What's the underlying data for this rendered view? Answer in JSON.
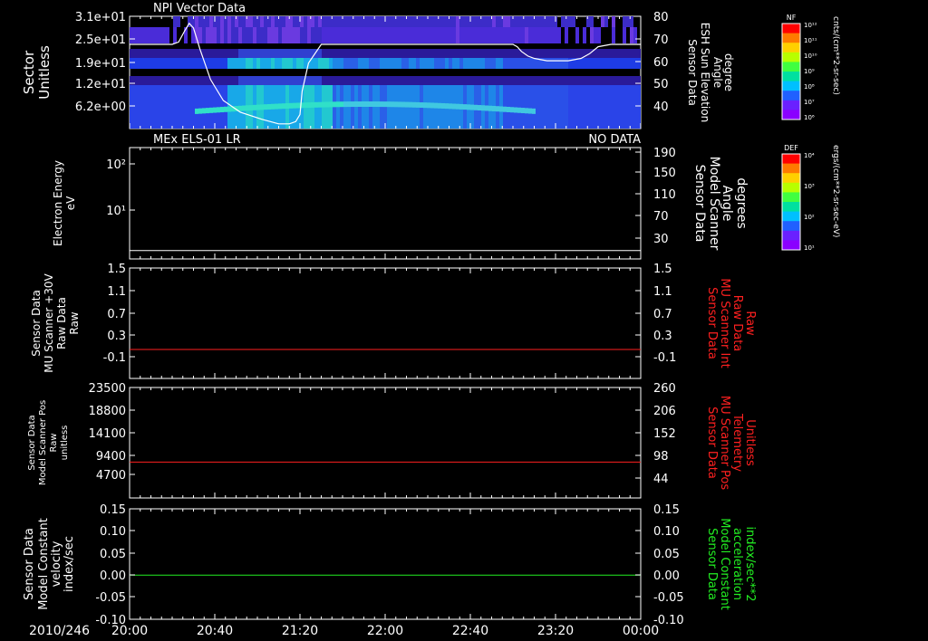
{
  "colors": {
    "frame": "#ffffff",
    "red_trace": "#ff2020",
    "green_trace": "#22ee22",
    "sun_curve": "#ffffff",
    "background": "#000000"
  },
  "panels": {
    "p1": {
      "title": "NPI Vector Data",
      "left_label": [
        "Sector",
        "Unitless"
      ],
      "right_label": [
        "Sensor Data",
        "ESH Sun Elevation",
        "Angle",
        "degree"
      ],
      "left_ticks": [
        "3.1e+01",
        "2.5e+01",
        "1.9e+01",
        "1.2e+01",
        "6.2e+00"
      ],
      "right_ticks": [
        "80",
        "70",
        "60",
        "50",
        "40"
      ],
      "colorbar": {
        "label": "NF",
        "units": "cnts/(cm**2-sr-sec)",
        "ticks": [
          "10¹²",
          "10¹¹",
          "10¹⁰",
          "10⁹",
          "10⁸",
          "10⁷",
          "10⁶"
        ]
      }
    },
    "p2": {
      "title": "MEx ELS-01 LR",
      "status": "NO DATA",
      "left_label": [
        "Electron Energy",
        "eV"
      ],
      "right_label": [
        "Sensor Data",
        "Model Scanner",
        "Angle",
        "degrees"
      ],
      "left_ticks": [
        "10²",
        "10¹"
      ],
      "right_ticks": [
        "190",
        "150",
        "110",
        "70",
        "30"
      ],
      "colorbar": {
        "label": "DEF",
        "units": "ergs/(cm**2-sr-sec-eV)",
        "ticks": [
          "10⁴",
          "10³",
          "10²",
          "10¹"
        ]
      }
    },
    "p3": {
      "left_label": [
        "Sensor Data",
        "MU Scanner +30V",
        "Raw Data",
        "Raw"
      ],
      "right_label": [
        "Sensor Data",
        "MU Scanner Int",
        "Raw Data",
        "Raw"
      ],
      "left_ticks": [
        "1.5",
        "1.1",
        "0.7",
        "0.3",
        "-0.1"
      ],
      "right_ticks": [
        "1.5",
        "1.1",
        "0.7",
        "0.3",
        "-0.1"
      ]
    },
    "p4": {
      "left_label": [
        "Sensor Data",
        "Model Scanner Pos",
        "Raw",
        "unitless"
      ],
      "right_label": [
        "Sensor Data",
        "MU Scanner Pos",
        "Telemetry",
        "Unitless"
      ],
      "left_ticks": [
        "23500",
        "18800",
        "14100",
        "9400",
        "4700"
      ],
      "right_ticks": [
        "260",
        "206",
        "152",
        "98",
        "44"
      ]
    },
    "p5": {
      "left_label": [
        "Sensor Data",
        "Model Constant",
        "velocity",
        "index/sec"
      ],
      "right_label": [
        "Sensor Data",
        "Model Constant",
        "acceleration",
        "index/sec**2"
      ],
      "left_ticks": [
        "0.15",
        "0.10",
        "0.05",
        "0.00",
        "-0.05",
        "-0.10"
      ],
      "right_ticks": [
        "0.15",
        "0.10",
        "0.05",
        "0.00",
        "-0.05",
        "-0.10"
      ]
    }
  },
  "time_axis": {
    "date": "2010/246",
    "ticks": [
      "20:00",
      "20:40",
      "21:20",
      "22:00",
      "22:40",
      "23:20",
      "00:00"
    ]
  },
  "chart_data": [
    {
      "type": "heatmap",
      "title": "NPI Vector Data",
      "ylabel": "Sector Unitless",
      "y2label": "Sensor Data ESH Sun Elevation Angle degree",
      "x_range": [
        "20:00",
        "00:00"
      ],
      "y2lim": [
        32,
        80
      ],
      "series": [
        {
          "name": "ESH Sun Elevation Angle",
          "x_minutes": [
            0,
            20,
            23,
            26,
            28,
            30,
            33,
            38,
            44,
            52,
            62,
            70,
            75,
            78,
            80,
            81,
            84,
            90,
            120,
            150,
            180,
            182,
            184,
            187,
            190,
            196,
            206,
            212,
            216,
            220,
            226,
            240
          ],
          "values": [
            68,
            68,
            69,
            74,
            77,
            75,
            66,
            53,
            44,
            39,
            36,
            34,
            34,
            35,
            38,
            48,
            60,
            68,
            68,
            68,
            68,
            67,
            65,
            63,
            62,
            61,
            61,
            62,
            64,
            67,
            68,
            68
          ]
        }
      ]
    },
    {
      "type": "line",
      "title": "MEx ELS-01 LR",
      "ylabel": "Electron Energy eV",
      "y2label": "Sensor Data Model Scanner Angle degrees",
      "y2lim": [
        0,
        190
      ],
      "series": [
        {
          "name": "Model Scanner Angle",
          "x_minutes": [
            0,
            240
          ],
          "values": [
            5,
            5
          ]
        }
      ]
    },
    {
      "type": "line",
      "ylabel": "Sensor Data MU Scanner +30V Raw Data Raw",
      "y2label": "Sensor Data MU Scanner Int Raw Data Raw",
      "ylim": [
        -0.3,
        1.5
      ],
      "series": [
        {
          "name": "MU Scanner Int Raw Data",
          "x_minutes": [
            0,
            240
          ],
          "values": [
            0.0,
            0.0
          ]
        }
      ]
    },
    {
      "type": "line",
      "ylabel": "Sensor Data Model Scanner Pos Raw unitless",
      "y2label": "Sensor Data MU Scanner Pos Telemetry Unitless",
      "ylim": [
        0,
        23500
      ],
      "series": [
        {
          "name": "MU Scanner Pos Telemetry",
          "x_minutes": [
            0,
            240
          ],
          "values": [
            7640,
            7640
          ]
        }
      ]
    },
    {
      "type": "line",
      "ylabel": "Sensor Data Model Constant velocity index/sec",
      "y2label": "Sensor Data Model Constant acceleration index/sec**2",
      "ylim": [
        -0.1,
        0.15
      ],
      "series": [
        {
          "name": "Model Constant acceleration",
          "x_minutes": [
            0,
            240
          ],
          "values": [
            0.0,
            0.0
          ]
        }
      ]
    }
  ]
}
